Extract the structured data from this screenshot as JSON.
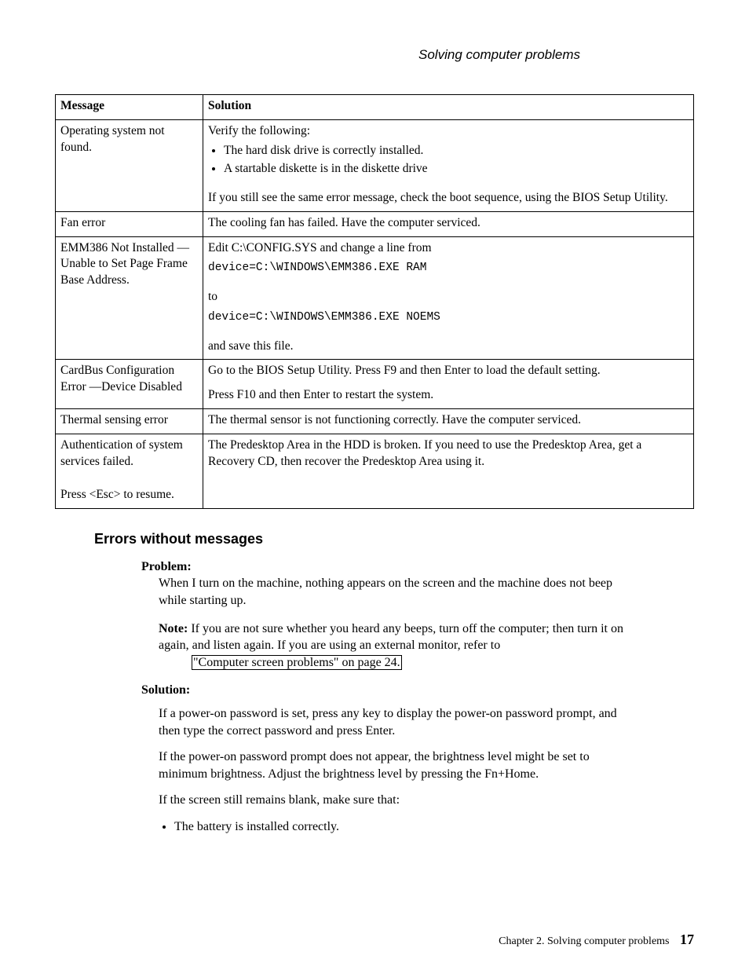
{
  "running_head": "Solving computer problems",
  "table": {
    "headers": {
      "message": "Message",
      "solution": "Solution"
    },
    "rows": [
      {
        "message": "Operating system not found.",
        "solution": {
          "intro": "Verify the following:",
          "bullets": [
            "The hard disk drive is correctly installed.",
            "A startable diskette is in the diskette drive"
          ],
          "outro": "If you still see the same error message, check the boot sequence, using the BIOS Setup Utility."
        }
      },
      {
        "message": "Fan error",
        "solution": {
          "text": "The cooling fan has failed. Have the computer serviced."
        }
      },
      {
        "message": "EMM386 Not Installed — Unable to Set Page Frame Base Address.",
        "solution": {
          "p1": "Edit C:\\CONFIG.SYS and change a line from",
          "code1": "device=C:\\WINDOWS\\EMM386.EXE RAM",
          "p2": "to",
          "code2": "device=C:\\WINDOWS\\EMM386.EXE NOEMS",
          "p3": "and save this file."
        }
      },
      {
        "message": "CardBus Configuration Error —Device Disabled",
        "solution": {
          "p1": "Go to the BIOS Setup Utility. Press F9 and then Enter to load the default setting.",
          "p2": "Press F10 and then Enter to restart the system."
        }
      },
      {
        "message": "Thermal sensing error",
        "solution": {
          "text": "The thermal sensor is not functioning correctly. Have the computer serviced."
        }
      },
      {
        "message": "Authentication of system services failed.\n\nPress <Esc> to resume.",
        "solution": {
          "text": "The Predesktop Area in the HDD is broken. If you need to use the Predesktop Area, get a Recovery CD, then recover the Predesktop Area using it."
        }
      }
    ]
  },
  "section_heading": "Errors without messages",
  "problem_label": "Problem:",
  "problem_text": "When I turn on the machine, nothing appears on the screen and the machine does not beep while starting up.",
  "note_label": "Note:",
  "note_text_1": "If you are not sure whether you heard any beeps, turn off the computer; then turn it on again, and listen again. If you are using an external monitor, refer to ",
  "note_link_text": "\"Computer screen problems\" on page 24.",
  "solution_label": "Solution:",
  "solution_p1": "If a power-on password is set, press any key to display the power-on password prompt, and then type the correct password and press Enter.",
  "solution_p2": "If the power-on password prompt does not appear, the brightness level might be set to minimum brightness. Adjust the brightness level by pressing the Fn+Home.",
  "solution_p3": "If the screen still remains blank, make sure that:",
  "solution_bullets": [
    "The battery is installed correctly."
  ],
  "footer": {
    "chapter": "Chapter 2. Solving computer problems",
    "page": "17"
  }
}
